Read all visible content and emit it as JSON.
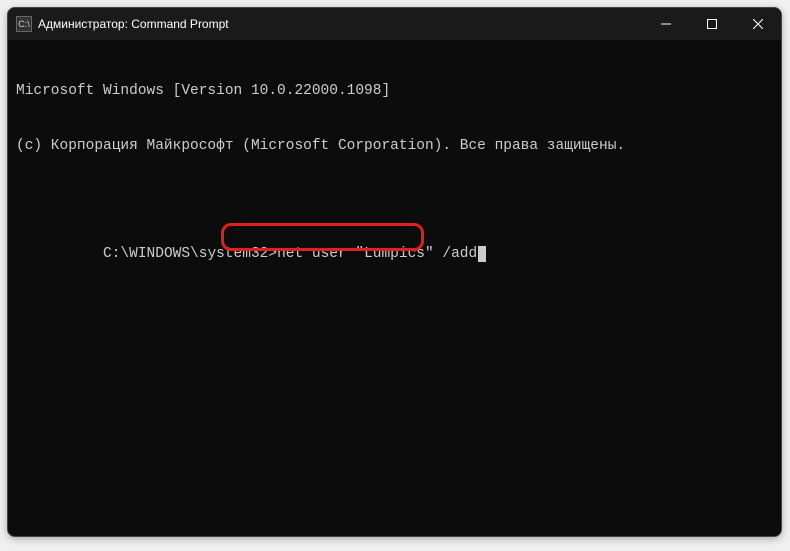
{
  "window": {
    "title": "Администратор: Command Prompt"
  },
  "terminal": {
    "line1": "Microsoft Windows [Version 10.0.22000.1098]",
    "line2": "(c) Корпорация Майкрософт (Microsoft Corporation). Все права защищены.",
    "prompt": "C:\\WINDOWS\\system32>",
    "command": "net user \"Lumpics\" /add"
  }
}
